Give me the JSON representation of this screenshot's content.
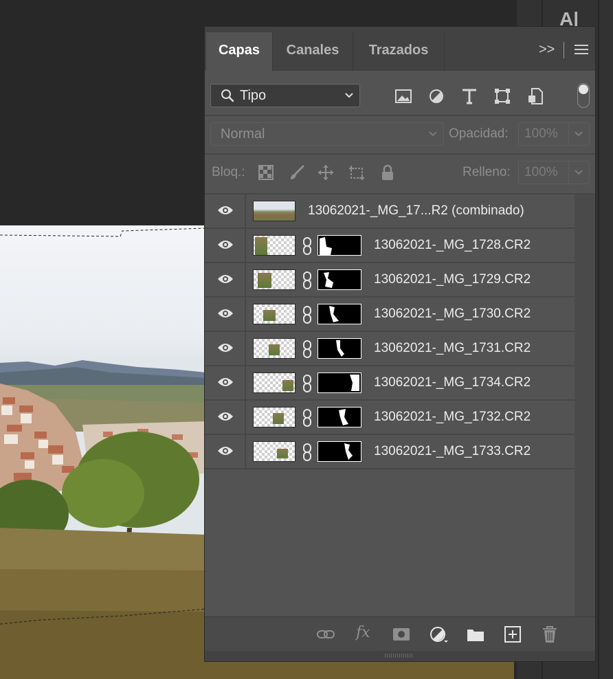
{
  "panel": {
    "tabs": [
      {
        "label": "Capas",
        "active": true
      },
      {
        "label": "Canales",
        "active": false
      },
      {
        "label": "Trazados",
        "active": false
      }
    ],
    "collapse_glyph": ">>"
  },
  "filter": {
    "kind_label": "Tipo",
    "icons": [
      "image-filter-icon",
      "adjustment-filter-icon",
      "type-filter-icon",
      "shape-filter-icon",
      "smart-object-filter-icon"
    ]
  },
  "blend": {
    "mode": "Normal",
    "opacity_label": "Opacidad:",
    "opacity_value": "100%"
  },
  "lock": {
    "label": "Bloq.:",
    "fill_label": "Relleno:",
    "fill_value": "100%",
    "icons": [
      "lock-transparent-icon",
      "lock-paint-icon",
      "lock-move-icon",
      "lock-artboard-icon",
      "lock-all-icon"
    ]
  },
  "layers": [
    {
      "name": "13062021-_MG_17...R2 (combinado)",
      "visible": true,
      "merged": true
    },
    {
      "name": "13062021-_MG_1728.CR2",
      "visible": true,
      "merged": false
    },
    {
      "name": "13062021-_MG_1729.CR2",
      "visible": true,
      "merged": false
    },
    {
      "name": "13062021-_MG_1730.CR2",
      "visible": true,
      "merged": false
    },
    {
      "name": "13062021-_MG_1731.CR2",
      "visible": true,
      "merged": false
    },
    {
      "name": "13062021-_MG_1734.CR2",
      "visible": true,
      "merged": false
    },
    {
      "name": "13062021-_MG_1732.CR2",
      "visible": true,
      "merged": false
    },
    {
      "name": "13062021-_MG_1733.CR2",
      "visible": true,
      "merged": false
    }
  ],
  "footer": {
    "fx_label": "fx",
    "icons": [
      "link-layers-icon",
      "fx-icon",
      "add-mask-icon",
      "new-adjustment-icon",
      "new-group-icon",
      "new-layer-icon",
      "trash-icon"
    ]
  },
  "right_dock": {
    "char_label": "A|"
  },
  "colors": {
    "panel_bg": "#535353",
    "tab_bar": "#424242",
    "app_bg": "#282828"
  }
}
